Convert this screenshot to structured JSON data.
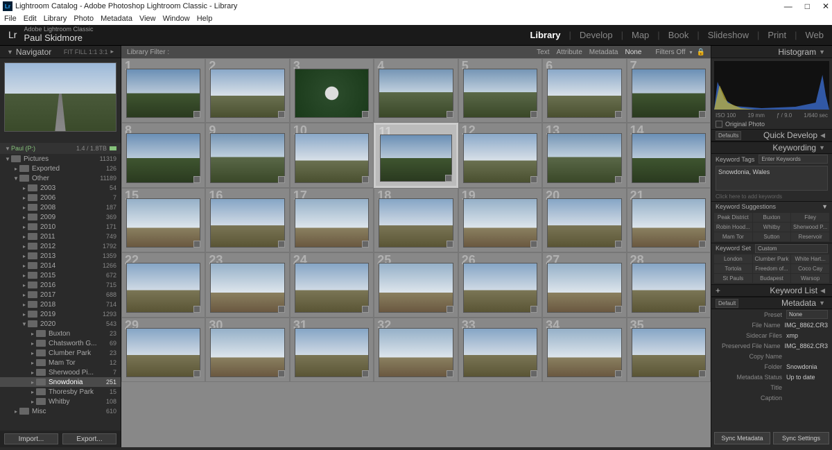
{
  "window": {
    "title": "Lightroom Catalog - Adobe Photoshop Lightroom Classic - Library",
    "logo_text": "Lr",
    "app_name": "Adobe Lightroom Classic",
    "user_name": "Paul Skidmore"
  },
  "menu": [
    "File",
    "Edit",
    "Library",
    "Photo",
    "Metadata",
    "View",
    "Window",
    "Help"
  ],
  "modules": [
    "Library",
    "Develop",
    "Map",
    "Book",
    "Slideshow",
    "Print",
    "Web"
  ],
  "active_module": "Library",
  "navigator": {
    "title": "Navigator",
    "modes": "FIT   FILL   1:1   3:1"
  },
  "volume": {
    "name": "Paul (P:)",
    "stat": "1.4 / 1.8TB"
  },
  "folders": [
    {
      "name": "Pictures",
      "count": "11319",
      "depth": 0,
      "open": true
    },
    {
      "name": "Exported",
      "count": "126",
      "depth": 1
    },
    {
      "name": "Other",
      "count": "11189",
      "depth": 1,
      "open": true
    },
    {
      "name": "2003",
      "count": "54",
      "depth": 2
    },
    {
      "name": "2006",
      "count": "7",
      "depth": 2
    },
    {
      "name": "2008",
      "count": "187",
      "depth": 2
    },
    {
      "name": "2009",
      "count": "369",
      "depth": 2
    },
    {
      "name": "2010",
      "count": "171",
      "depth": 2
    },
    {
      "name": "2011",
      "count": "749",
      "depth": 2
    },
    {
      "name": "2012",
      "count": "1792",
      "depth": 2
    },
    {
      "name": "2013",
      "count": "1359",
      "depth": 2
    },
    {
      "name": "2014",
      "count": "1266",
      "depth": 2
    },
    {
      "name": "2015",
      "count": "672",
      "depth": 2
    },
    {
      "name": "2016",
      "count": "715",
      "depth": 2
    },
    {
      "name": "2017",
      "count": "688",
      "depth": 2
    },
    {
      "name": "2018",
      "count": "714",
      "depth": 2
    },
    {
      "name": "2019",
      "count": "1293",
      "depth": 2
    },
    {
      "name": "2020",
      "count": "543",
      "depth": 2,
      "open": true
    },
    {
      "name": "Buxton",
      "count": "23",
      "depth": 3
    },
    {
      "name": "Chatsworth G...",
      "count": "69",
      "depth": 3
    },
    {
      "name": "Clumber Park",
      "count": "23",
      "depth": 3
    },
    {
      "name": "Mam Tor",
      "count": "12",
      "depth": 3
    },
    {
      "name": "Sherwood Pi...",
      "count": "7",
      "depth": 3
    },
    {
      "name": "Snowdonia",
      "count": "251",
      "depth": 3,
      "sel": true
    },
    {
      "name": "Thoresby Park",
      "count": "15",
      "depth": 3
    },
    {
      "name": "Whitby",
      "count": "108",
      "depth": 3
    },
    {
      "name": "Misc",
      "count": "610",
      "depth": 1
    }
  ],
  "buttons": {
    "import": "Import...",
    "export": "Export..."
  },
  "filter": {
    "label": "Library Filter :",
    "tabs": [
      "Text",
      "Attribute",
      "Metadata",
      "None"
    ],
    "active": "None",
    "right": "Filters Off"
  },
  "grid": {
    "count": 35,
    "selected": 11,
    "variant": [
      1,
      2,
      "sign",
      3,
      3,
      2,
      1,
      1,
      3,
      2,
      1,
      2,
      3,
      1,
      4,
      5,
      4,
      5,
      4,
      5,
      4,
      5,
      4,
      5,
      4,
      5,
      4,
      5,
      5,
      4,
      5,
      4,
      5,
      4,
      5
    ]
  },
  "right": {
    "histogram": "Histogram",
    "histo_info": {
      "iso": "ISO 100",
      "fl": "19 mm",
      "ap": "ƒ / 9.0",
      "ss": "1/640 sec"
    },
    "original": "Original Photo",
    "quick_develop": "Quick Develop",
    "defaults": "Defaults",
    "keywording": "Keywording",
    "kw_tags": "Keyword Tags",
    "kw_enter": "Enter Keywords",
    "keywords": "Snowdonia, Wales",
    "kw_hint": "Click here to add keywords",
    "kw_suggestions": "Keyword Suggestions",
    "suggestions": [
      "Peak District",
      "Buxton",
      "Filey",
      "Robin Hood...",
      "Whitby",
      "Sherwood P...",
      "Mam Tor",
      "Sutton",
      "Reservoir"
    ],
    "kw_set": "Keyword Set",
    "kw_set_val": "Custom",
    "set_items": [
      "London",
      "Clumber Park",
      "White Hart...",
      "Tortola",
      "Freedom of...",
      "Coco Cay",
      "St Pauls",
      "Budapest",
      "Warsop"
    ],
    "kw_list": "Keyword List",
    "metadata": "Metadata",
    "meta_default": "Default",
    "preset_lbl": "Preset",
    "preset_val": "None",
    "meta": [
      {
        "l": "File Name",
        "v": "IMG_8862.CR3"
      },
      {
        "l": "Sidecar Files",
        "v": "xmp"
      },
      {
        "l": "Preserved File Name",
        "v": "IMG_8862.CR3"
      },
      {
        "l": "Copy Name",
        "v": ""
      },
      {
        "l": "Folder",
        "v": "Snowdonia"
      },
      {
        "l": "Metadata Status",
        "v": "Up to date"
      },
      {
        "l": "Title",
        "v": ""
      },
      {
        "l": "Caption",
        "v": ""
      }
    ],
    "sync1": "Sync Metadata",
    "sync2": "Sync Settings"
  }
}
